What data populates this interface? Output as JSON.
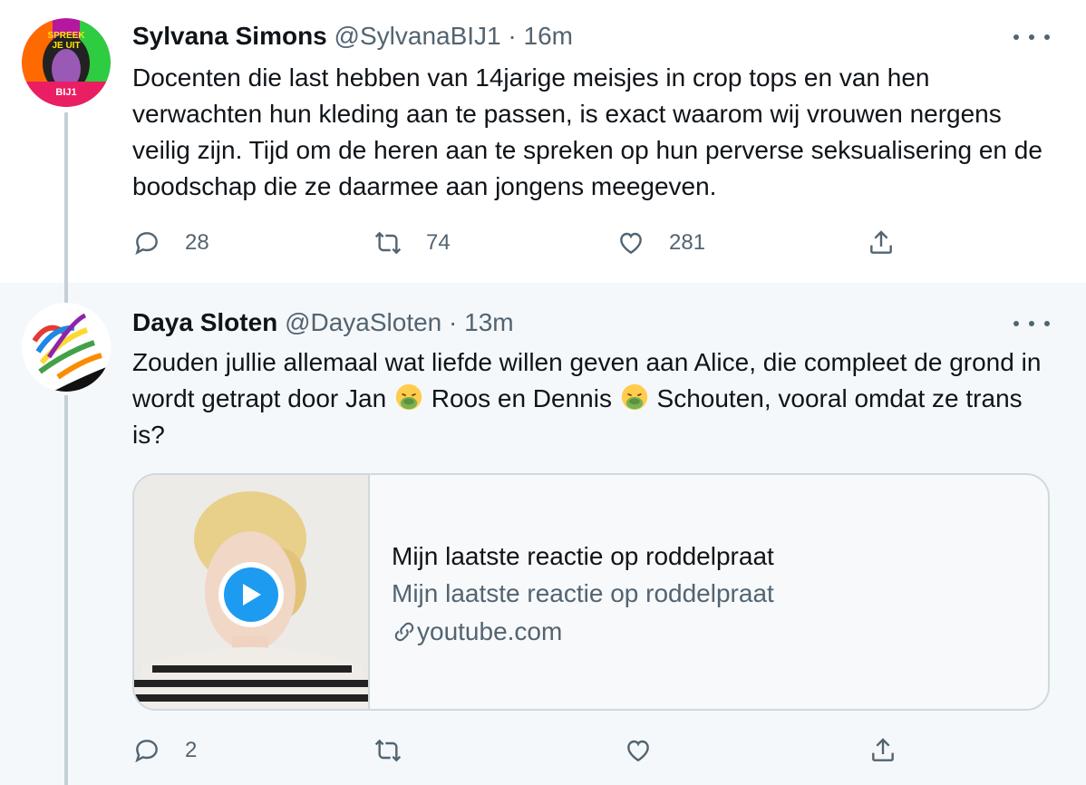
{
  "tweets": [
    {
      "name": "Sylvana Simons",
      "handle": "@SylvanaBIJ1",
      "dot": "·",
      "time": "16m",
      "avatar_text": [
        "SPREEK",
        "JE UIT",
        "BIJ1"
      ],
      "text": "Docenten die last hebben van 14jarige meisjes in crop tops en van hen verwachten hun kleding aan te passen,  is exact waarom wij vrouwen nergens veilig zijn.  Tijd om de heren aan te spreken op hun perverse seksualisering en de boodschap die ze daarmee aan jongens meegeven.",
      "replies": "28",
      "retweets": "74",
      "likes": "281"
    },
    {
      "name": "Daya Sloten",
      "handle": "@DayaSloten",
      "dot": "·",
      "time": "13m",
      "text_parts": [
        "Zouden jullie allemaal wat liefde willen geven aan Alice, die compleet de grond in wordt getrapt door Jan ",
        " Roos en Dennis ",
        " Schouten, vooral omdat ze trans is?"
      ],
      "emoji": "nauseated-face-icon",
      "replies": "2",
      "retweets": "",
      "likes": "",
      "card": {
        "title": "Mijn laatste reactie op roddelpraat",
        "description": "Mijn laatste reactie op roddelpraat",
        "domain": "youtube.com"
      }
    }
  ],
  "colors": {
    "accent": "#1d9bf0",
    "secondary_text": "#536471",
    "thread_line": "#c4cfd6",
    "selected_bg": "#f5f8fa"
  }
}
